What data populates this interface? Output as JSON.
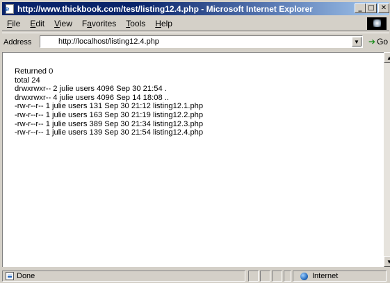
{
  "window": {
    "title": "http://www.thickbook.com/test/listing12.4.php - Microsoft Internet Explorer"
  },
  "menu": {
    "items": [
      "File",
      "Edit",
      "View",
      "Favorites",
      "Tools",
      "Help"
    ],
    "accelerators": [
      "F",
      "E",
      "V",
      "a",
      "T",
      "H"
    ]
  },
  "address": {
    "label": "Address",
    "url": "http://localhost/listing12.4.php",
    "go_label": "Go"
  },
  "content": {
    "lines": [
      "Returned 0",
      "total 24",
      "drwxrwxr-- 2 julie users 4096 Sep 30 21:54 .",
      "drwxrwxr-- 4 julie users 4096 Sep 14 18:08 ..",
      "-rw-r--r-- 1 julie users 131 Sep 30 21:12 listing12.1.php",
      "-rw-r--r-- 1 julie users 163 Sep 30 21:19 listing12.2.php",
      "-rw-r--r-- 1 julie users 389 Sep 30 21:34 listing12.3.php",
      "-rw-r--r-- 1 julie users 139 Sep 30 21:54 listing12.4.php"
    ]
  },
  "status": {
    "text": "Done",
    "zone": "Internet"
  },
  "icons": {
    "app": "ie-page-icon",
    "minimize": "minimize-icon",
    "maximize": "maximize-icon",
    "close": "close-icon",
    "go": "go-arrow-icon",
    "status_page": "page-icon",
    "zone": "globe-icon"
  }
}
